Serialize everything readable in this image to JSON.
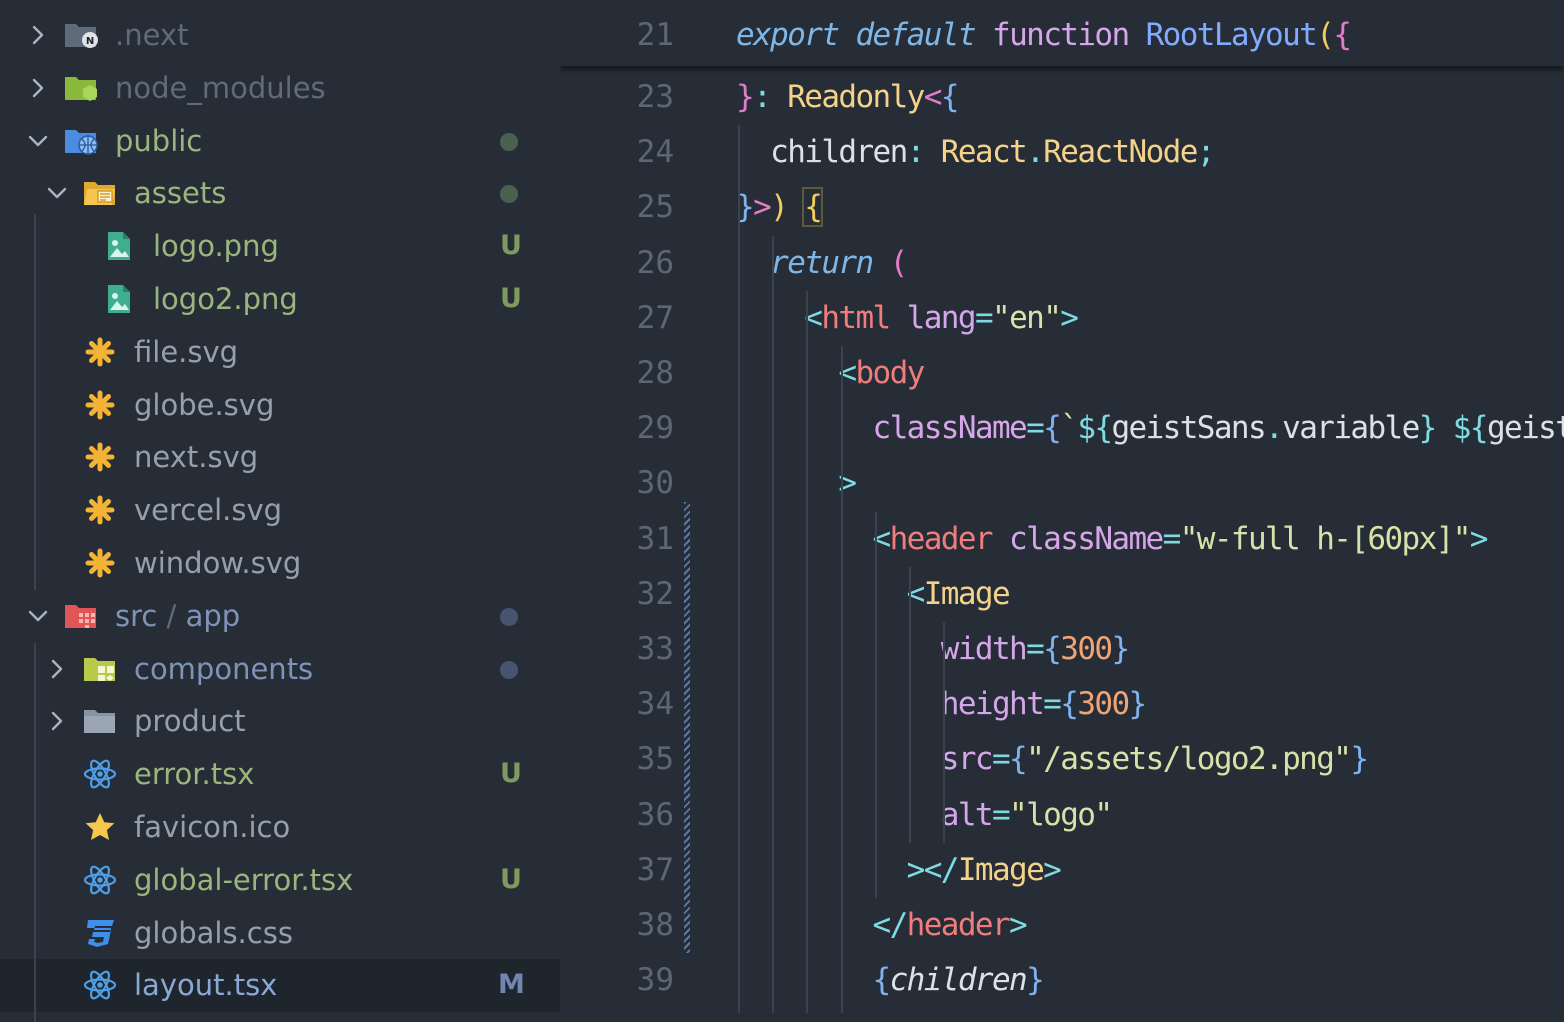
{
  "explorer": {
    "items": [
      {
        "label": ".next",
        "kind": "folder",
        "icon": "next-folder-icon",
        "expanded": false,
        "color": "#5f6b78",
        "status": "",
        "dot": ""
      },
      {
        "label": "node_modules",
        "kind": "folder",
        "icon": "node-folder-icon",
        "expanded": false,
        "color": "#5f6b78",
        "status": "",
        "dot": ""
      },
      {
        "label": "public",
        "kind": "folder",
        "icon": "public-folder-icon",
        "expanded": true,
        "color": "#9bb57e",
        "status": "",
        "dot": "#4b6150"
      },
      {
        "label": "assets",
        "kind": "folder",
        "icon": "assets-folder-icon",
        "expanded": true,
        "color": "#9bb57e",
        "status": "",
        "dot": "#4b6150"
      },
      {
        "label": "logo.png",
        "kind": "file",
        "icon": "image-file-icon",
        "color": "#9bb57e",
        "status": "U",
        "dot": ""
      },
      {
        "label": "logo2.png",
        "kind": "file",
        "icon": "image-file-icon",
        "color": "#9bb57e",
        "status": "U",
        "dot": ""
      },
      {
        "label": "file.svg",
        "kind": "file",
        "icon": "svg-file-icon",
        "color": "#96a0ab",
        "status": "",
        "dot": ""
      },
      {
        "label": "globe.svg",
        "kind": "file",
        "icon": "svg-file-icon",
        "color": "#96a0ab",
        "status": "",
        "dot": ""
      },
      {
        "label": "next.svg",
        "kind": "file",
        "icon": "svg-file-icon",
        "color": "#96a0ab",
        "status": "",
        "dot": ""
      },
      {
        "label": "vercel.svg",
        "kind": "file",
        "icon": "svg-file-icon",
        "color": "#96a0ab",
        "status": "",
        "dot": ""
      },
      {
        "label": "window.svg",
        "kind": "file",
        "icon": "svg-file-icon",
        "color": "#96a0ab",
        "status": "",
        "dot": ""
      },
      {
        "label": "src",
        "label2": "app",
        "kind": "folder",
        "icon": "src-folder-icon",
        "expanded": true,
        "color": "#7f93b8",
        "status": "",
        "dot": "#465470"
      },
      {
        "label": "components",
        "kind": "folder",
        "icon": "components-folder-icon",
        "expanded": false,
        "color": "#7f93b8",
        "status": "",
        "dot": "#465470"
      },
      {
        "label": "product",
        "kind": "folder",
        "icon": "folder-icon",
        "expanded": false,
        "color": "#96a0ab",
        "status": "",
        "dot": ""
      },
      {
        "label": "error.tsx",
        "kind": "file",
        "icon": "react-file-icon",
        "color": "#9bb57e",
        "status": "U",
        "dot": ""
      },
      {
        "label": "favicon.ico",
        "kind": "file",
        "icon": "favicon-star-icon",
        "color": "#96a0ab",
        "status": "",
        "dot": ""
      },
      {
        "label": "global-error.tsx",
        "kind": "file",
        "icon": "react-file-icon",
        "color": "#9bb57e",
        "status": "U",
        "dot": ""
      },
      {
        "label": "globals.css",
        "kind": "file",
        "icon": "css-file-icon",
        "color": "#96a0ab",
        "status": "",
        "dot": ""
      },
      {
        "label": "layout.tsx",
        "kind": "file",
        "icon": "react-file-icon",
        "color": "#8aa8d6",
        "status": "M",
        "dot": "",
        "active": true
      }
    ]
  },
  "editor": {
    "sticky": {
      "num": "21",
      "tokens": [
        {
          "t": "export",
          "c": "#7fb6e6",
          "i": true
        },
        {
          "t": " "
        },
        {
          "t": "default",
          "c": "#7fb6e6",
          "i": true
        },
        {
          "t": " "
        },
        {
          "t": "function",
          "c": "#d6a6ea"
        },
        {
          "t": " "
        },
        {
          "t": "RootLayout",
          "c": "#82aaff"
        },
        {
          "t": "(",
          "c": "#f2cd5c"
        },
        {
          "t": "{",
          "c": "#e27cc8"
        }
      ]
    },
    "lines": [
      {
        "num": "23",
        "tokens": [
          {
            "t": "}",
            "c": "#e27cc8"
          },
          {
            "t": ": ",
            "c": "#7fdbe3"
          },
          {
            "t": "Readonly",
            "c": "#f5d28a"
          },
          {
            "t": "<",
            "c": "#e27cc8"
          },
          {
            "t": "{",
            "c": "#7fb3f0"
          }
        ]
      },
      {
        "num": "24",
        "tokens": [
          {
            "t": "  children",
            "c": "#dbe1e8"
          },
          {
            "t": ": ",
            "c": "#7fdbe3"
          },
          {
            "t": "React",
            "c": "#f5d28a"
          },
          {
            "t": ".",
            "c": "#7fdbe3"
          },
          {
            "t": "ReactNode",
            "c": "#f5d28a"
          },
          {
            "t": ";",
            "c": "#7fdbe3"
          }
        ]
      },
      {
        "num": "25",
        "tokens": [
          {
            "t": "}",
            "c": "#7fb3f0"
          },
          {
            "t": ">",
            "c": "#e27cc8"
          },
          {
            "t": ") ",
            "c": "#f2cd5c"
          },
          {
            "t": "{",
            "c": "#f2cd5c",
            "box": true
          }
        ]
      },
      {
        "num": "26",
        "tokens": [
          {
            "t": "  return",
            "c": "#7fb6e6",
            "i": true
          },
          {
            "t": " "
          },
          {
            "t": "(",
            "c": "#e27cc8"
          }
        ]
      },
      {
        "num": "27",
        "tokens": [
          {
            "t": "    <",
            "c": "#7fdbe3"
          },
          {
            "t": "html",
            "c": "#ef7d7d"
          },
          {
            "t": " "
          },
          {
            "t": "lang",
            "c": "#d6a6ea"
          },
          {
            "t": "=",
            "c": "#7fdbe3"
          },
          {
            "t": "\"en\"",
            "c": "#d8e2a8"
          },
          {
            "t": ">",
            "c": "#7fdbe3"
          }
        ]
      },
      {
        "num": "28",
        "tokens": [
          {
            "t": "      <",
            "c": "#7fdbe3"
          },
          {
            "t": "body",
            "c": "#ef7d7d"
          }
        ]
      },
      {
        "num": "29",
        "tokens": [
          {
            "t": "        className",
            "c": "#d6a6ea"
          },
          {
            "t": "=",
            "c": "#7fdbe3"
          },
          {
            "t": "{",
            "c": "#7fb3f0"
          },
          {
            "t": "`",
            "c": "#d8e2a8"
          },
          {
            "t": "${",
            "c": "#7fdbe3"
          },
          {
            "t": "geistSans",
            "c": "#dbe1e8"
          },
          {
            "t": ".",
            "c": "#7fdbe3"
          },
          {
            "t": "variable",
            "c": "#dbe1e8"
          },
          {
            "t": "}",
            "c": "#7fdbe3"
          },
          {
            "t": " ",
            "c": "#d8e2a8"
          },
          {
            "t": "${",
            "c": "#7fdbe3"
          },
          {
            "t": "geistMono",
            "c": "#dbe1e8"
          }
        ]
      },
      {
        "num": "30",
        "tokens": [
          {
            "t": "      >",
            "c": "#7fdbe3"
          }
        ]
      },
      {
        "num": "31",
        "tokens": [
          {
            "t": "        <",
            "c": "#7fdbe3"
          },
          {
            "t": "header",
            "c": "#ef7d7d"
          },
          {
            "t": " "
          },
          {
            "t": "className",
            "c": "#d6a6ea"
          },
          {
            "t": "=",
            "c": "#7fdbe3"
          },
          {
            "t": "\"w-full h-[60px]\"",
            "c": "#d8e2a8"
          },
          {
            "t": ">",
            "c": "#7fdbe3"
          }
        ]
      },
      {
        "num": "32",
        "tokens": [
          {
            "t": "          <",
            "c": "#7fdbe3"
          },
          {
            "t": "Image",
            "c": "#f5d28a"
          }
        ]
      },
      {
        "num": "33",
        "tokens": [
          {
            "t": "            width",
            "c": "#d6a6ea"
          },
          {
            "t": "=",
            "c": "#7fdbe3"
          },
          {
            "t": "{",
            "c": "#7fb3f0"
          },
          {
            "t": "300",
            "c": "#f0a474"
          },
          {
            "t": "}",
            "c": "#7fb3f0"
          }
        ]
      },
      {
        "num": "34",
        "tokens": [
          {
            "t": "            height",
            "c": "#d6a6ea"
          },
          {
            "t": "=",
            "c": "#7fdbe3"
          },
          {
            "t": "{",
            "c": "#7fb3f0"
          },
          {
            "t": "300",
            "c": "#f0a474"
          },
          {
            "t": "}",
            "c": "#7fb3f0"
          }
        ]
      },
      {
        "num": "35",
        "tokens": [
          {
            "t": "            src",
            "c": "#d6a6ea"
          },
          {
            "t": "=",
            "c": "#7fdbe3"
          },
          {
            "t": "{",
            "c": "#7fb3f0"
          },
          {
            "t": "\"/assets/logo2.png\"",
            "c": "#d8e2a8"
          },
          {
            "t": "}",
            "c": "#7fb3f0"
          }
        ]
      },
      {
        "num": "36",
        "tokens": [
          {
            "t": "            alt",
            "c": "#d6a6ea"
          },
          {
            "t": "=",
            "c": "#7fdbe3"
          },
          {
            "t": "\"logo\"",
            "c": "#d8e2a8"
          }
        ]
      },
      {
        "num": "37",
        "tokens": [
          {
            "t": "          ></",
            "c": "#7fdbe3"
          },
          {
            "t": "Image",
            "c": "#f5d28a"
          },
          {
            "t": ">",
            "c": "#7fdbe3"
          }
        ]
      },
      {
        "num": "38",
        "tokens": [
          {
            "t": "        </",
            "c": "#7fdbe3"
          },
          {
            "t": "header",
            "c": "#ef7d7d"
          },
          {
            "t": ">",
            "c": "#7fdbe3"
          }
        ]
      },
      {
        "num": "39",
        "tokens": [
          {
            "t": "        {",
            "c": "#7fb3f0"
          },
          {
            "t": "children",
            "c": "#dbe1e8",
            "i": true
          },
          {
            "t": "}",
            "c": "#7fb3f0"
          }
        ]
      }
    ]
  }
}
